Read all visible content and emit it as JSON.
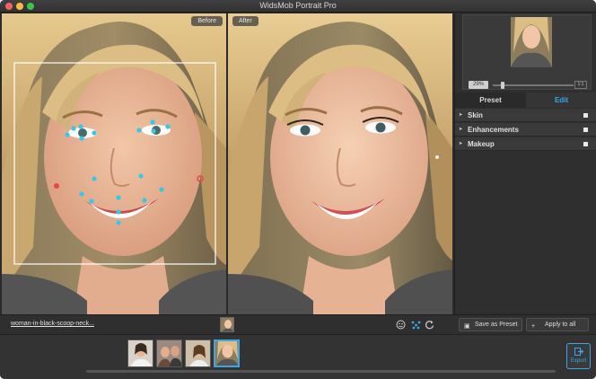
{
  "window": {
    "title": "WidsMob Portrait Pro"
  },
  "compare": {
    "before_label": "Before",
    "after_label": "After"
  },
  "navigator": {
    "zoom_percent": "29%",
    "fit_label": "1:1",
    "zoom_level": 0.12
  },
  "tabs": [
    {
      "label": "Preset"
    },
    {
      "label": "Edit"
    }
  ],
  "sections": [
    {
      "label": "Skin"
    },
    {
      "label": "Enhancements"
    },
    {
      "label": "Makeup"
    }
  ],
  "bottom": {
    "file_name": "woman-in-black-scoop-neck...",
    "save_preset_label": "Save as Preset",
    "apply_all_label": "Apply to all"
  },
  "filmstrip": {
    "selected_index": 3,
    "count": 4
  },
  "export": {
    "label": "Export"
  },
  "colors": {
    "accent": "#3aa7e6",
    "landmark": "#38c7e8",
    "landmark_alt": "#e84545"
  }
}
